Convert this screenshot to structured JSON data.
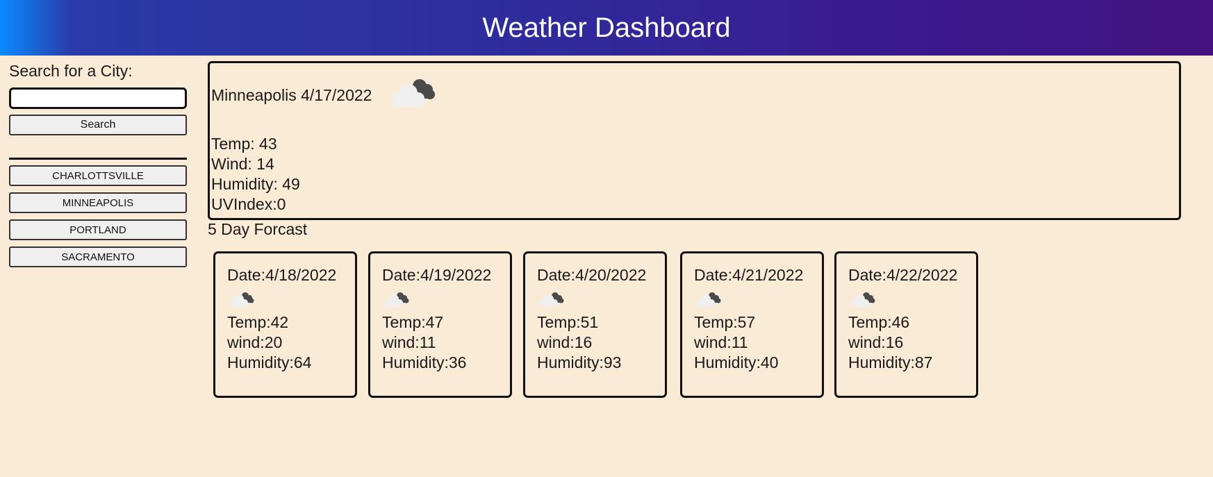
{
  "header": {
    "title": "Weather Dashboard"
  },
  "sidebar": {
    "search_label": "Search for a City:",
    "search_input_value": "",
    "search_button_label": "Search",
    "history": [
      "CHARLOTTSVILLE",
      "MINNEAPOLIS",
      "PORTLAND",
      "SACRAMENTO"
    ]
  },
  "current": {
    "city_date": "Minneapolis 4/17/2022",
    "icon": "broken-clouds-icon",
    "temp": "Temp: 43",
    "wind": "Wind: 14",
    "humidity": "Humidity: 49",
    "uv": "UVIndex:0"
  },
  "forecast": {
    "heading": "5 Day Forcast",
    "days": [
      {
        "date": "Date:4/18/2022",
        "icon": "broken-clouds-icon",
        "temp": "Temp:42",
        "wind": "wind:20",
        "humidity": "Humidity:64"
      },
      {
        "date": "Date:4/19/2022",
        "icon": "broken-clouds-icon",
        "temp": "Temp:47",
        "wind": "wind:11",
        "humidity": "Humidity:36"
      },
      {
        "date": "Date:4/20/2022",
        "icon": "broken-clouds-icon",
        "temp": "Temp:51",
        "wind": "wind:16",
        "humidity": "Humidity:93"
      },
      {
        "date": "Date:4/21/2022",
        "icon": "broken-clouds-icon",
        "temp": "Temp:57",
        "wind": "wind:11",
        "humidity": "Humidity:40"
      },
      {
        "date": "Date:4/22/2022",
        "icon": "broken-clouds-icon",
        "temp": "Temp:46",
        "wind": "wind:16",
        "humidity": "Humidity:87"
      }
    ]
  },
  "colors": {
    "background": "#faebd7",
    "header_start": "#0a8cff",
    "header_end": "#43127e",
    "header_text": "#ffffff"
  }
}
